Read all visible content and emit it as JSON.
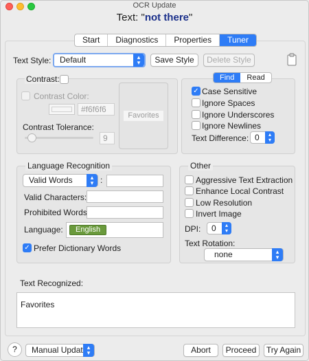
{
  "window": {
    "title": "OCR Update"
  },
  "header": {
    "prefix": "Text: \"",
    "value": "not there",
    "suffix": "\""
  },
  "tabs": [
    "Start",
    "Diagnostics",
    "Properties",
    "Tuner"
  ],
  "text_style": {
    "label": "Text Style:",
    "selected": "Default",
    "save_label": "Save Style",
    "delete_label": "Delete Style"
  },
  "contrast": {
    "label": "Contrast:",
    "color_label": "Contrast Color:",
    "color_value": "#f6f6f6",
    "swatch_color": "#f6f6f6",
    "tolerance_label": "Contrast Tolerance:",
    "tolerance_value": "9",
    "preview_text": "Favorites"
  },
  "find_panel": {
    "segments": [
      "Find",
      "Read"
    ],
    "case_sensitive": "Case Sensitive",
    "ignore_spaces": "Ignore Spaces",
    "ignore_underscores": "Ignore Underscores",
    "ignore_newlines": "Ignore Newlines",
    "text_difference_label": "Text Difference:",
    "text_difference_value": "0"
  },
  "language": {
    "title": "Language Recognition",
    "mode": "Valid Words",
    "colon": ":",
    "valid_chars_label": "Valid Characters:",
    "prohibited_label": "Prohibited Words:",
    "language_label": "Language:",
    "language_tag": "English",
    "prefer_dictionary": "Prefer Dictionary Words"
  },
  "other": {
    "title": "Other",
    "aggressive": "Aggressive Text Extraction",
    "enhance": "Enhance Local Contrast",
    "low_res": "Low Resolution",
    "invert": "Invert Image",
    "dpi_label": "DPI:",
    "dpi_value": "0",
    "rotation_label": "Text Rotation:",
    "rotation_value": "none"
  },
  "recognized": {
    "label": "Text Recognized:",
    "value": "Favorites"
  },
  "footer": {
    "help": "?",
    "update_mode": "Manual Update",
    "abort": "Abort",
    "proceed": "Proceed",
    "try_again": "Try Again"
  },
  "colors": {
    "accent": "#2e7cf6",
    "english_tag": "#6a9a3c",
    "title_value": "#1a2f8a"
  }
}
